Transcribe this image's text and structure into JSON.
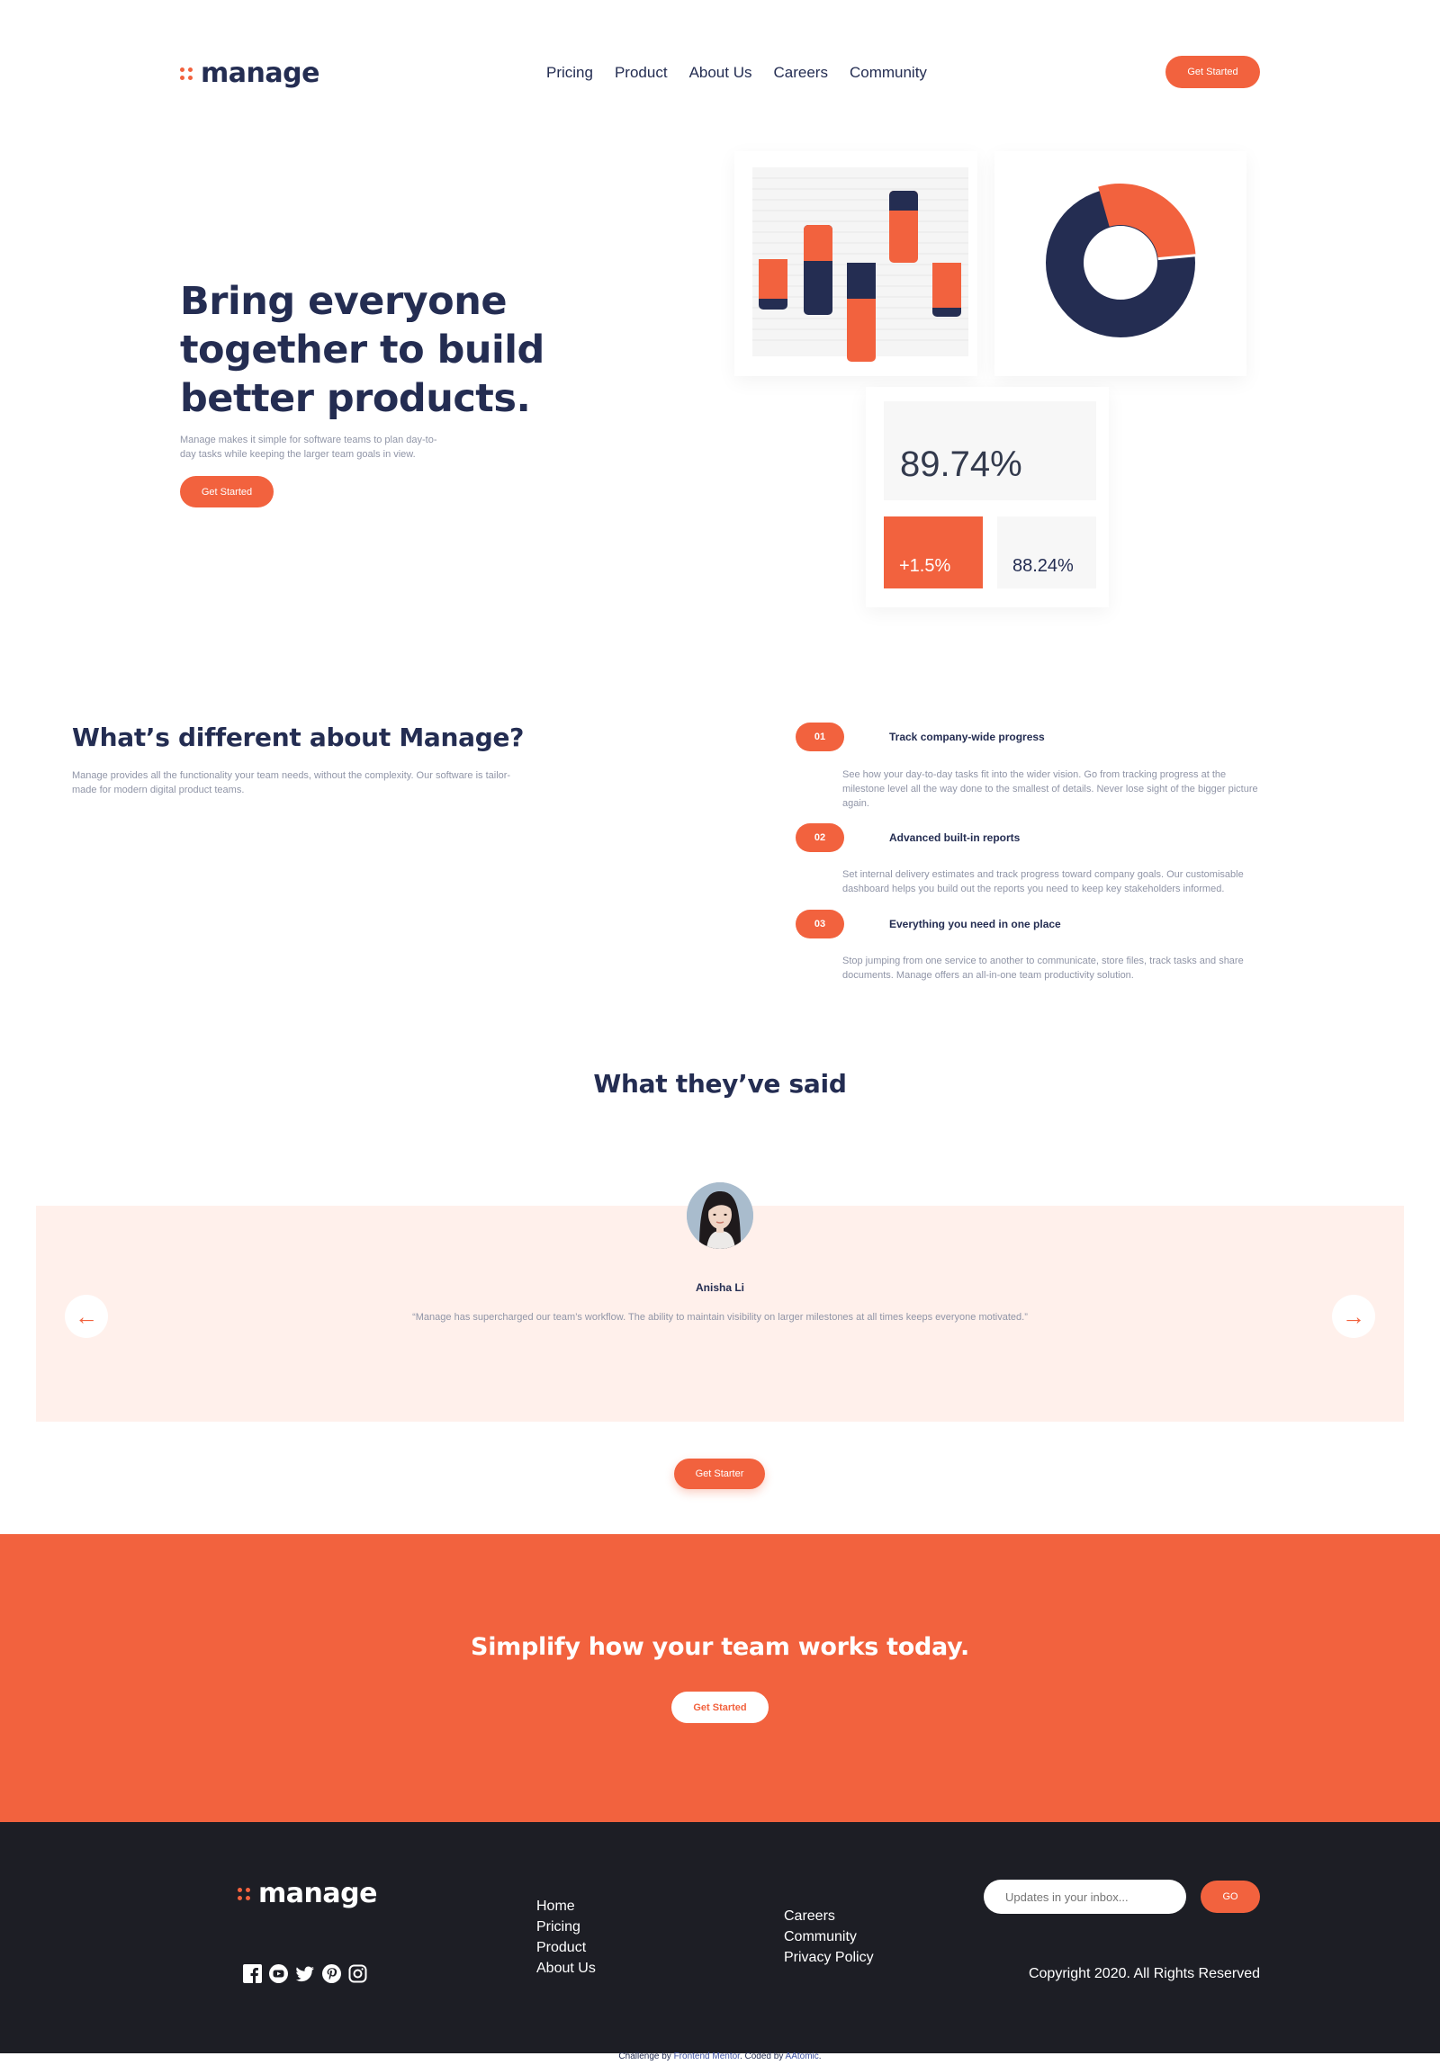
{
  "colors": {
    "accent": "#f2623e",
    "navy": "#242d52",
    "pale": "#fff0eb",
    "dark": "#1d1e25"
  },
  "header": {
    "brand": "manage",
    "nav": [
      "Pricing",
      "Product",
      "About Us",
      "Careers",
      "Community"
    ],
    "cta_label": "Get Started"
  },
  "hero": {
    "title_lines": [
      "Bring everyone",
      "together to build",
      "better products."
    ],
    "desc_lines": [
      "Manage makes it simple for software teams to plan day-to-",
      "day tasks while keeping the larger team goals in view."
    ],
    "cta_label": "Get Started",
    "stats": {
      "main": "89.74%",
      "change": "+1.5%",
      "secondary": "88.24%"
    }
  },
  "features": {
    "title": "What’s different about Manage?",
    "desc_lines": [
      "Manage provides all the functionality your team needs, without the complexity. Our software is tailor-",
      "made for modern digital product teams."
    ],
    "items": [
      {
        "num": "01",
        "title": "Track company-wide progress",
        "desc_lines": [
          "See how your day-to-day tasks fit into the wider vision. Go from tracking progress at the",
          "milestone level all the way done to the smallest of details. Never lose sight of the bigger picture",
          "again."
        ]
      },
      {
        "num": "02",
        "title": "Advanced built-in reports",
        "desc_lines": [
          "Set internal delivery estimates and track progress toward company goals. Our customisable",
          "dashboard helps you build out the reports you need to keep key stakeholders informed."
        ]
      },
      {
        "num": "03",
        "title": "Everything you need in one place",
        "desc_lines": [
          "Stop jumping from one service to another to communicate, store files, track tasks and share",
          "documents. Manage offers an all-in-one team productivity solution."
        ]
      }
    ]
  },
  "testimonials": {
    "title": "What they’ve said",
    "name": "Anisha Li",
    "quote": "“Manage has supercharged our team’s workflow. The ability to maintain visibility on larger milestones at all times keeps everyone motivated.”",
    "prev_icon": "←",
    "next_icon": "→",
    "cta_label": "Get Starter"
  },
  "cta_banner": {
    "title": "Simplify how your team works today.",
    "cta_label": "Get Started"
  },
  "footer": {
    "brand": "manage",
    "links_col1": [
      "Home",
      "Pricing",
      "Product",
      "About Us"
    ],
    "links_col2": [
      "Careers",
      "Community",
      "Privacy Policy"
    ],
    "newsletter_placeholder": "Updates in your inbox...",
    "go_label": "GO",
    "copyright": "Copyright 2020. All Rights Reserved",
    "socials": [
      "facebook-icon",
      "youtube-icon",
      "twitter-icon",
      "pinterest-icon",
      "instagram-icon"
    ]
  },
  "attribution": {
    "prefix": "Challenge by ",
    "fm": "Frontend Mentor",
    "middle": ". Coded by ",
    "author": "AAtomic",
    "suffix": "."
  }
}
